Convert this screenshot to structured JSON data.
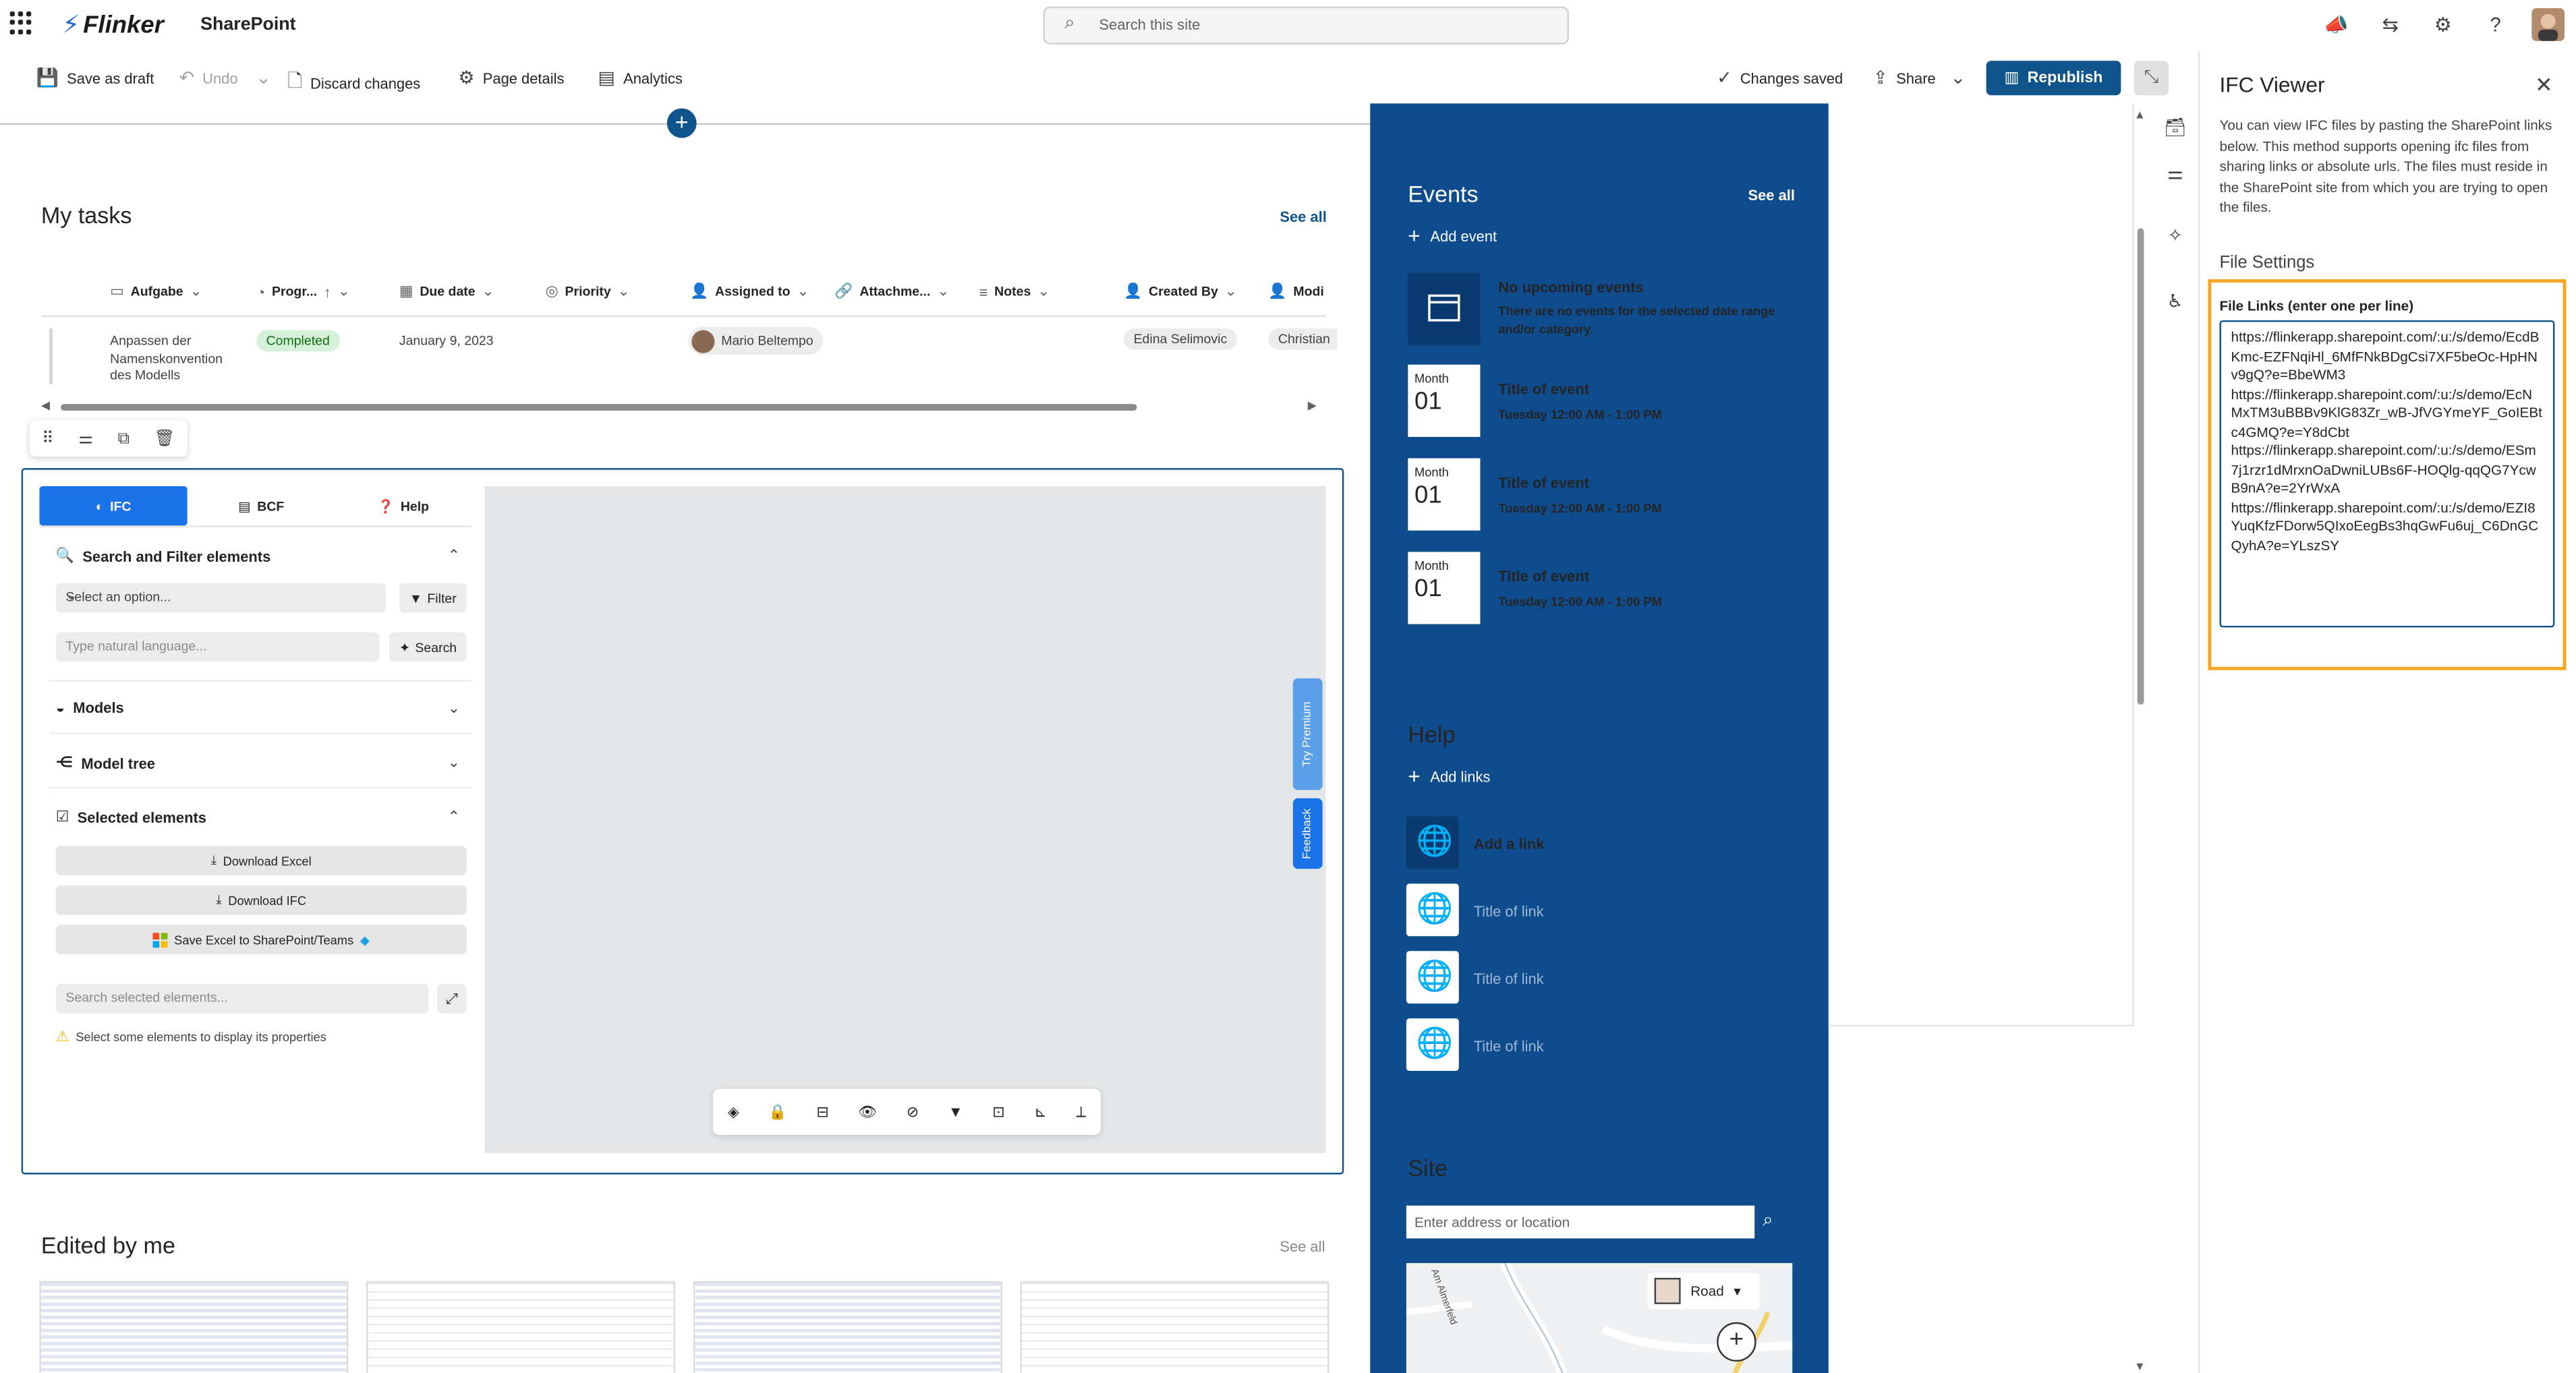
{
  "suite": {
    "brand": "Flinker",
    "app": "SharePoint",
    "search_placeholder": "Search this site"
  },
  "commands": {
    "save_draft": "Save as draft",
    "undo": "Undo",
    "discard": "Discard changes",
    "page_details": "Page details",
    "analytics": "Analytics",
    "status": "Changes saved",
    "share": "Share",
    "republish": "Republish"
  },
  "tasks": {
    "title": "My tasks",
    "see_all": "See all",
    "columns": [
      "Aufgabe",
      "Progr...",
      "Due date",
      "Priority",
      "Assigned to",
      "Attachme...",
      "Notes",
      "Created By",
      "Modi"
    ],
    "row": {
      "name": "Anpassen der Namenskonvention des Modells",
      "status": "Completed",
      "due": "January 9, 2023",
      "assigned": "Mario Beltempo",
      "created_by": "Edina Selimovic",
      "modified_by": "Christian"
    }
  },
  "ifc": {
    "tabs": [
      "IFC",
      "BCF",
      "Help"
    ],
    "search_section": "Search and Filter elements",
    "select_placeholder": "Select an option...",
    "filter_label": "Filter",
    "nl_placeholder": "Type natural language...",
    "search_label": "Search",
    "models_section": "Models",
    "tree_section": "Model tree",
    "selected_section": "Selected elements",
    "download_excel": "Download Excel",
    "download_ifc": "Download IFC",
    "save_excel": "Save Excel to SharePoint/Teams",
    "sel_search_placeholder": "Search selected elements...",
    "hint": "Select some elements to display its properties",
    "try_premium": "Try Premium",
    "feedback": "Feedback"
  },
  "edited": {
    "title": "Edited by me",
    "see_all": "See all"
  },
  "events": {
    "title": "Events",
    "see_all": "See all",
    "add": "Add event",
    "none_title": "No upcoming events",
    "none_text": "There are no events for the selected date range and/or category.",
    "items": [
      {
        "month": "Month",
        "day": "01",
        "title": "Title of event",
        "time": "Tuesday 12:00 AM - 1:00 PM"
      },
      {
        "month": "Month",
        "day": "01",
        "title": "Title of event",
        "time": "Tuesday 12:00 AM - 1:00 PM"
      },
      {
        "month": "Month",
        "day": "01",
        "title": "Title of event",
        "time": "Tuesday 12:00 AM - 1:00 PM"
      }
    ]
  },
  "help": {
    "title": "Help",
    "add": "Add links",
    "links": [
      "Add a link",
      "Title of link",
      "Title of link",
      "Title of link"
    ]
  },
  "site": {
    "title": "Site",
    "address_placeholder": "Enter address or location",
    "map_style": "Road",
    "map_street": "Am Almerfeld"
  },
  "panel": {
    "title": "IFC Viewer",
    "description": "You can view IFC files by pasting the SharePoint links below. This method supports opening ifc files from sharing links or absolute urls. The files must reside in the SharePoint site from which you are trying to open the files.",
    "settings_title": "File Settings",
    "links_label": "File Links (enter one per line)",
    "links_value": "https://flinkerapp.sharepoint.com/:u:/s/demo/EcdBKmc-EZFNqiHl_6MfFNkBDgCsi7XF5beOc-HpHNv9gQ?e=BbeWM3\nhttps://flinkerapp.sharepoint.com/:u:/s/demo/EcNMxTM3uBBBv9KlG83Zr_wB-JfVGYmeYF_GoIEBtc4GMQ?e=Y8dCbt\nhttps://flinkerapp.sharepoint.com/:u:/s/demo/ESm7j1rzr1dMrxnOaDwniLUBs6F-HOQlg-qqQG7YcwB9nA?e=2YrWxA\nhttps://flinkerapp.sharepoint.com/:u:/s/demo/EZI8YuqKfzFDorw5QIxoEegBs3hqGwFu6uj_C6DnGCQyhA?e=YLszSY"
  },
  "colors": {
    "brand": "#0f548c",
    "blue_column": "#0f4c8d",
    "highlight": "#f5a623",
    "ifc_tab": "#1a73e8"
  }
}
